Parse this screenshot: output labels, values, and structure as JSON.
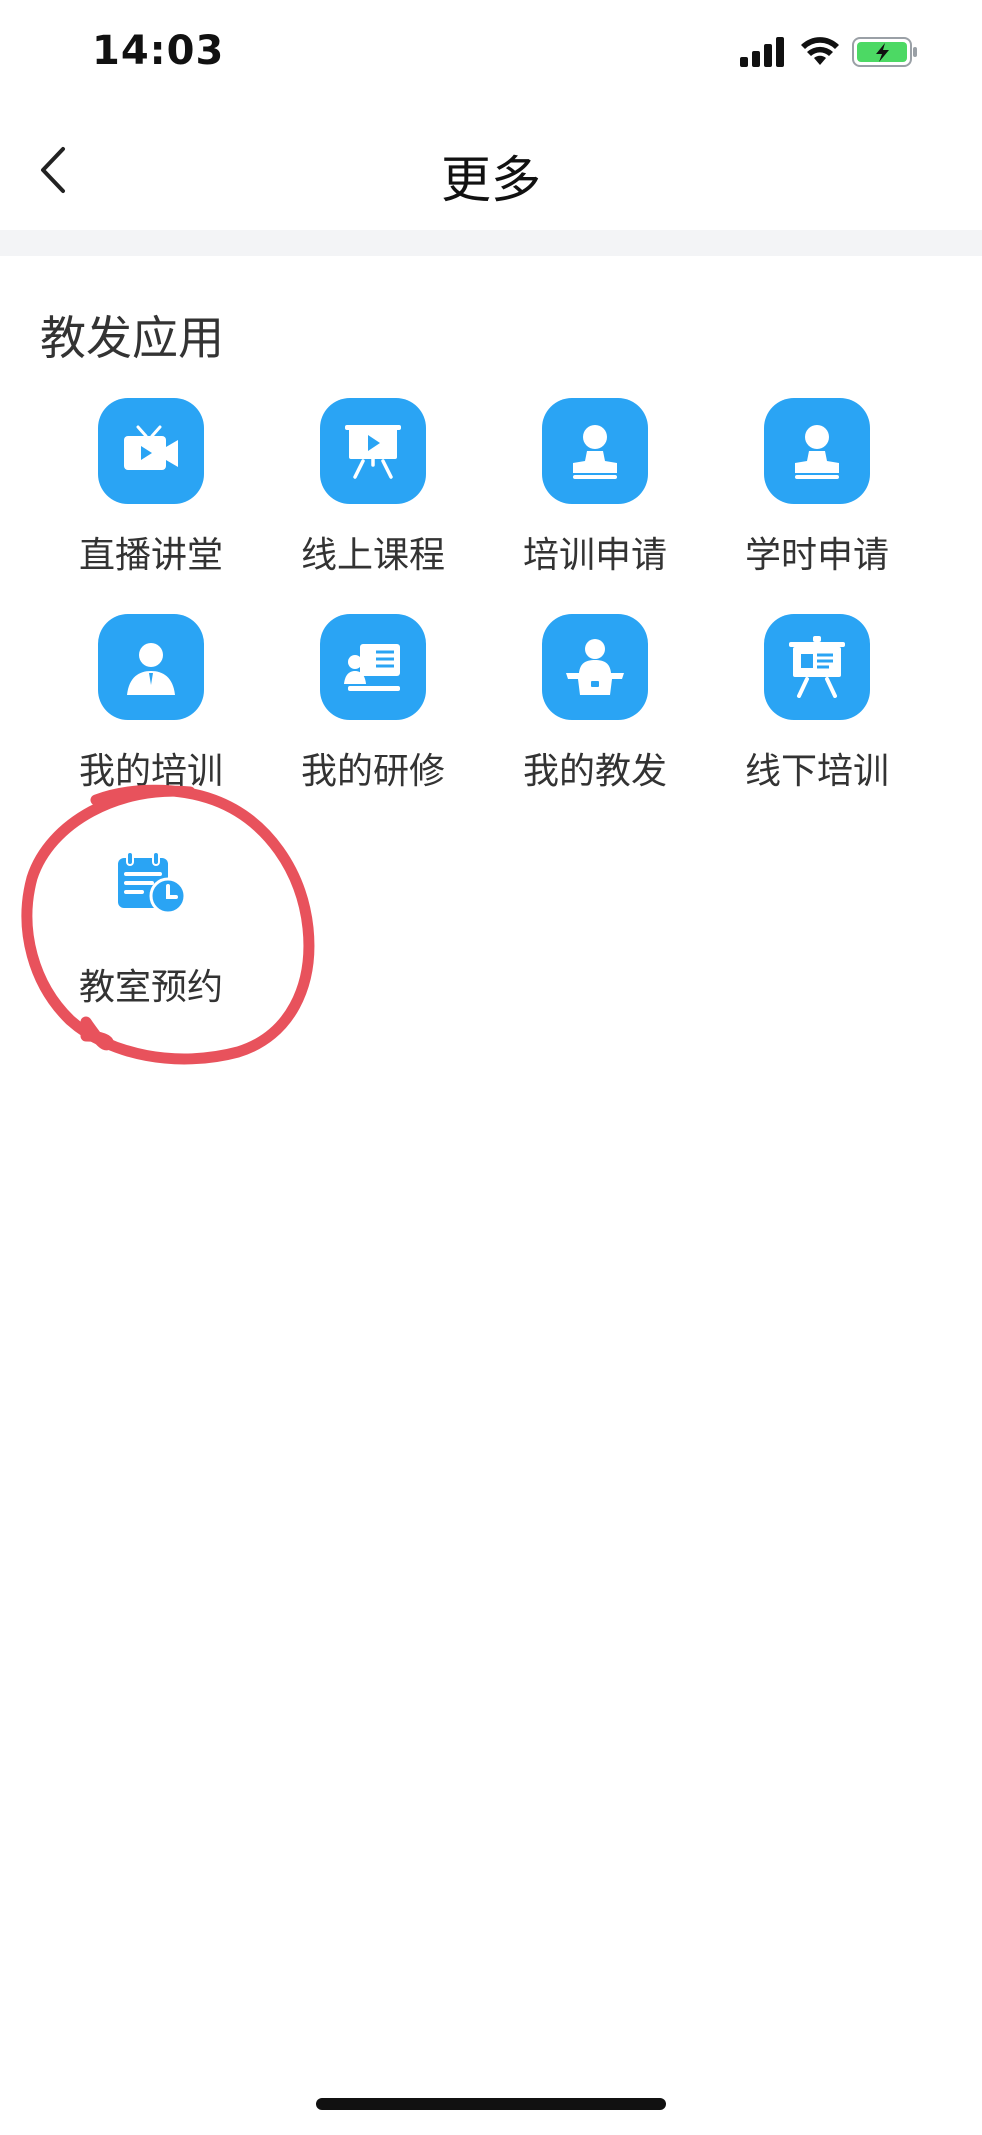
{
  "status_bar": {
    "time": "14:03",
    "icons": [
      "signal-icon",
      "wifi-icon",
      "battery-charging-icon"
    ],
    "battery_color": "#4cd964"
  },
  "nav": {
    "back_icon": "chevron-left-icon",
    "title": "更多"
  },
  "section": {
    "title": "教发应用"
  },
  "apps": [
    {
      "label": "直播讲堂",
      "icon": "live-tv-icon"
    },
    {
      "label": "线上课程",
      "icon": "presentation-play-icon"
    },
    {
      "label": "培训申请",
      "icon": "user-stamp-icon"
    },
    {
      "label": "学时申请",
      "icon": "user-stamp-icon"
    },
    {
      "label": "我的培训",
      "icon": "person-icon"
    },
    {
      "label": "我的研修",
      "icon": "lecture-board-icon"
    },
    {
      "label": "我的教发",
      "icon": "speaker-podium-icon"
    },
    {
      "label": "线下培训",
      "icon": "easel-board-icon"
    },
    {
      "label": "教室预约",
      "icon": "calendar-clock-icon"
    }
  ],
  "colors": {
    "accent": "#2aa4f4",
    "annotation": "#e8525c"
  }
}
